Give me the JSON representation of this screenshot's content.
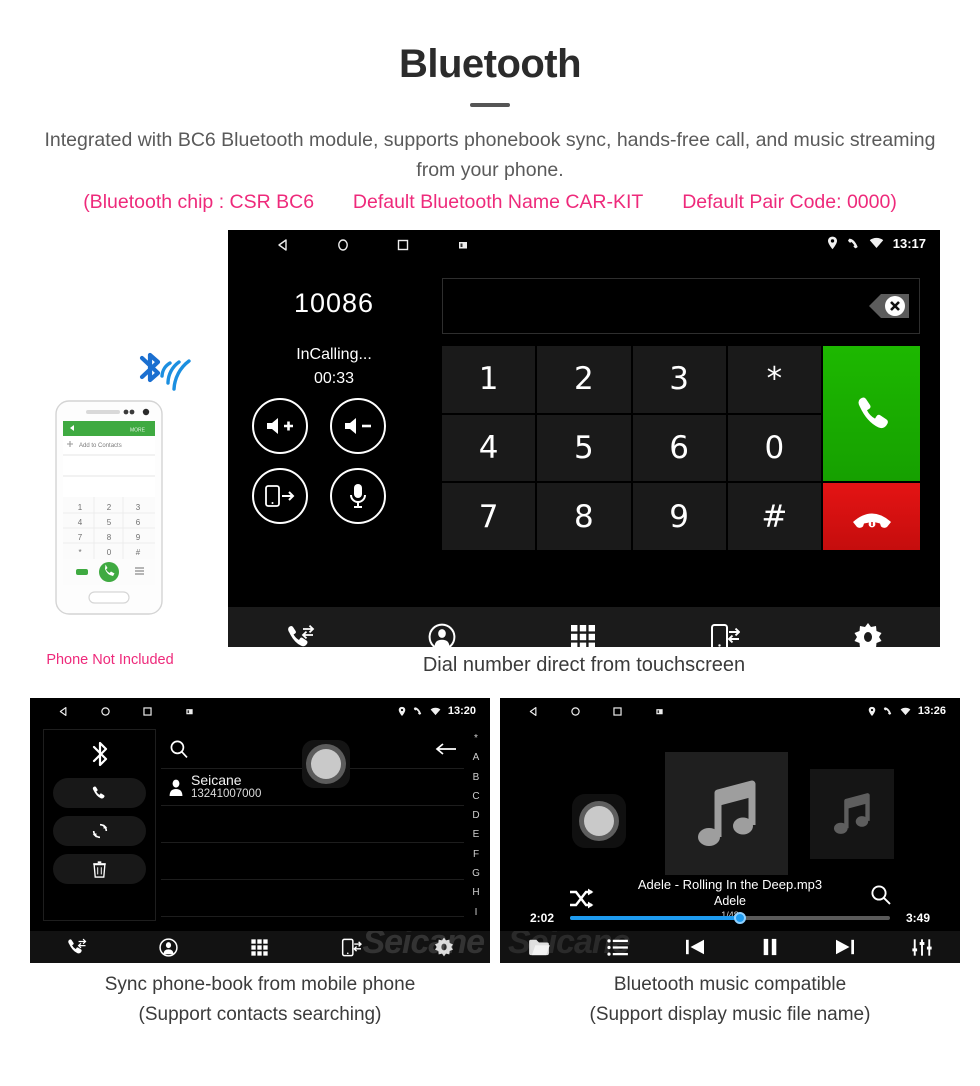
{
  "header": {
    "title": "Bluetooth",
    "subtitle": "Integrated with BC6 Bluetooth module, supports phonebook sync, hands-free call, and music streaming from your phone.",
    "spec_chip": "(Bluetooth chip : CSR BC6",
    "spec_name": "Default Bluetooth Name CAR-KIT",
    "spec_pair": "Default Pair Code: 0000)",
    "accent_pink": "#ee2a7b",
    "body_gray": "#5a5a5a"
  },
  "dialer": {
    "statusbar": {
      "time": "13:17",
      "left_icons": [
        "back-icon",
        "home-icon",
        "recents-icon",
        "screenshot-icon"
      ],
      "right_icons": [
        "location-icon",
        "phone-icon",
        "wifi-icon"
      ]
    },
    "caller_number": "10086",
    "call_status": "InCalling...",
    "call_timer": "00:33",
    "input_value": "",
    "controls": [
      {
        "name": "volume-up-button",
        "icon": "speaker-plus-icon"
      },
      {
        "name": "volume-down-button",
        "icon": "speaker-minus-icon"
      },
      {
        "name": "transfer-to-phone-button",
        "icon": "phone-transfer-icon"
      },
      {
        "name": "mute-microphone-button",
        "icon": "microphone-icon"
      }
    ],
    "keys": [
      "1",
      "2",
      "3",
      "*",
      "4",
      "5",
      "6",
      "0",
      "7",
      "8",
      "9",
      "#"
    ],
    "call_button": "call-icon",
    "end_button": "end-call-icon",
    "nav_icons": [
      "call-log-icon",
      "contacts-icon",
      "dialpad-icon",
      "phone-sync-icon",
      "settings-gear-icon"
    ],
    "green_hex": "#1db800",
    "red_hex": "#e41414"
  },
  "phone_mock": {
    "header_action": "MORE",
    "add_contacts": "Add to Contacts",
    "keys": [
      "1",
      "2",
      "3",
      "4",
      "5",
      "6",
      "7",
      "8",
      "9",
      "*",
      "0",
      "#"
    ],
    "caption": "Phone Not Included"
  },
  "captions": {
    "dialer": "Dial number direct from touchscreen",
    "contacts_line1": "Sync phone-book from mobile phone",
    "contacts_line2": "(Support contacts searching)",
    "music_line1": "Bluetooth music compatible",
    "music_line2": "(Support display music file name)"
  },
  "contacts": {
    "statusbar": {
      "time": "13:20"
    },
    "rail_icons": [
      "bluetooth-icon",
      "call-icon",
      "sync-icon",
      "delete-icon"
    ],
    "search_placeholder": "",
    "back_icon": "back-arrow-icon",
    "list": [
      {
        "name": "Seicane",
        "number": "13241007000"
      }
    ],
    "alpha_index": [
      "*",
      "A",
      "B",
      "C",
      "D",
      "E",
      "F",
      "G",
      "H",
      "I"
    ],
    "nav_icons": [
      "call-log-icon",
      "contacts-icon",
      "dialpad-icon",
      "phone-sync-icon",
      "settings-gear-icon"
    ],
    "watermark": "Seicane"
  },
  "music": {
    "statusbar": {
      "time": "13:26"
    },
    "track_title": "Adele - Rolling In the Deep.mp3",
    "artist": "Adele",
    "track_count": "1/48",
    "elapsed": "2:02",
    "duration": "3:49",
    "progress_percent": 53,
    "shuffle_icon": "shuffle-icon",
    "search_icon": "search-icon",
    "nav_icons": [
      "folder-icon",
      "playlist-icon",
      "previous-icon",
      "pause-icon",
      "next-icon",
      "equalizer-icon"
    ],
    "progress_hex": "#1e9bf0",
    "watermark": "Seicane"
  }
}
